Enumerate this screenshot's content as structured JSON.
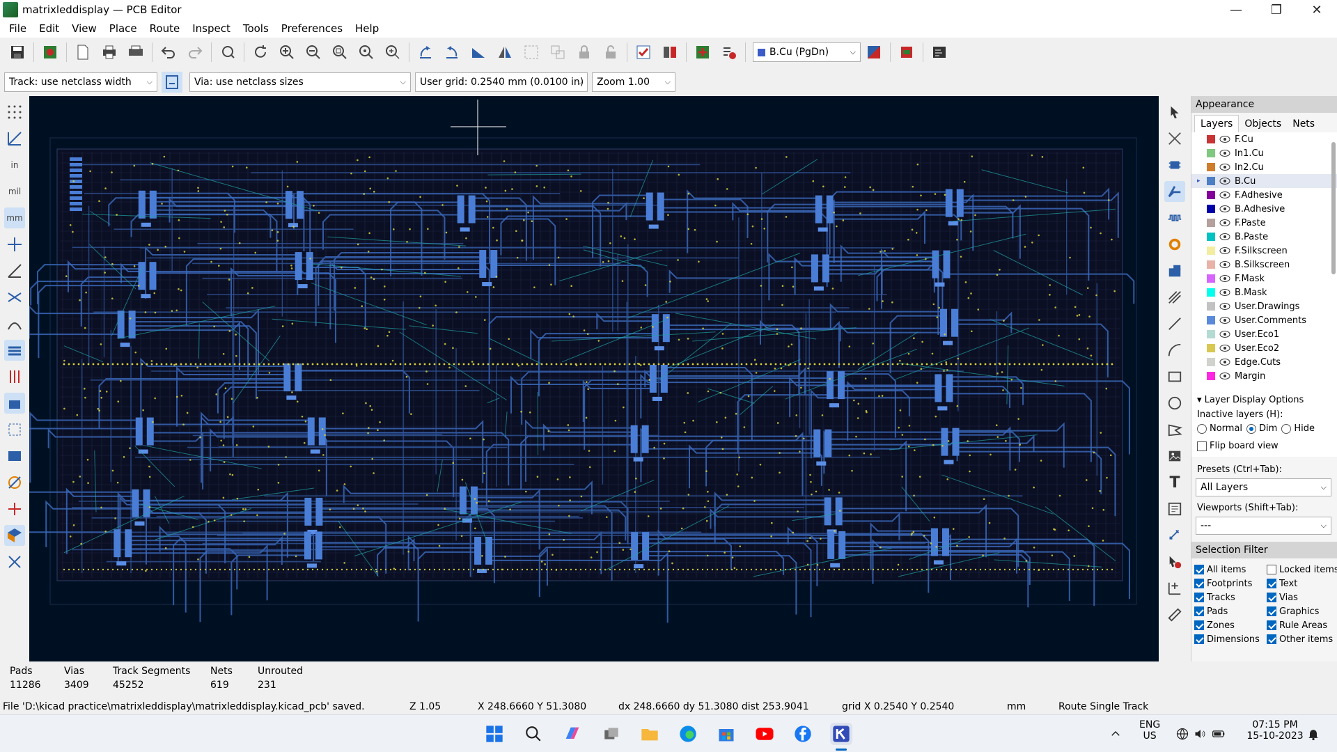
{
  "window": {
    "title": "matrixleddisplay — PCB Editor",
    "controls": [
      "—",
      "❐",
      "✕"
    ]
  },
  "menu": [
    "File",
    "Edit",
    "View",
    "Place",
    "Route",
    "Inspect",
    "Tools",
    "Preferences",
    "Help"
  ],
  "toolbar": {
    "layer_selector": "B.Cu (PgDn)",
    "track_width": "Track: use netclass width",
    "via_size": "Via: use netclass sizes",
    "grid": "User grid: 0.2540 mm (0.0100 in)",
    "zoom": "Zoom 1.00"
  },
  "appearance": {
    "title": "Appearance",
    "tabs": [
      "Layers",
      "Objects",
      "Nets"
    ],
    "layers": [
      {
        "name": "F.Cu",
        "color": "#c83434"
      },
      {
        "name": "In1.Cu",
        "color": "#7fc87f"
      },
      {
        "name": "In2.Cu",
        "color": "#ce7d2c"
      },
      {
        "name": "B.Cu",
        "color": "#4d7fc4"
      },
      {
        "name": "F.Adhesive",
        "color": "#84009b"
      },
      {
        "name": "B.Adhesive",
        "color": "#0000a8"
      },
      {
        "name": "F.Paste",
        "color": "#b4a09c"
      },
      {
        "name": "B.Paste",
        "color": "#00c2c2"
      },
      {
        "name": "F.Silkscreen",
        "color": "#f2eda1"
      },
      {
        "name": "B.Silkscreen",
        "color": "#e8b2a7"
      },
      {
        "name": "F.Mask",
        "color": "#d864ff"
      },
      {
        "name": "B.Mask",
        "color": "#02ffee"
      },
      {
        "name": "User.Drawings",
        "color": "#c2c2c2"
      },
      {
        "name": "User.Comments",
        "color": "#5989db"
      },
      {
        "name": "User.Eco1",
        "color": "#b4dbd2"
      },
      {
        "name": "User.Eco2",
        "color": "#d8c852"
      },
      {
        "name": "Edge.Cuts",
        "color": "#d0d2cd"
      },
      {
        "name": "Margin",
        "color": "#ff26e2"
      }
    ],
    "current_layer": "B.Cu",
    "layer_display_options": "Layer Display Options",
    "inactive_layers_label": "Inactive layers (H):",
    "inactive_options": [
      "Normal",
      "Dim",
      "Hide"
    ],
    "inactive_selected": "Dim",
    "flip_board": "Flip board view",
    "presets_label": "Presets (Ctrl+Tab):",
    "presets_value": "All Layers",
    "viewports_label": "Viewports (Shift+Tab):",
    "viewports_value": "---"
  },
  "selection_filter": {
    "title": "Selection Filter",
    "items": [
      {
        "label": "All items",
        "checked": true
      },
      {
        "label": "Locked items",
        "checked": false
      },
      {
        "label": "Footprints",
        "checked": true
      },
      {
        "label": "Text",
        "checked": true
      },
      {
        "label": "Tracks",
        "checked": true
      },
      {
        "label": "Vias",
        "checked": true
      },
      {
        "label": "Pads",
        "checked": true
      },
      {
        "label": "Graphics",
        "checked": true
      },
      {
        "label": "Zones",
        "checked": true
      },
      {
        "label": "Rule Areas",
        "checked": true
      },
      {
        "label": "Dimensions",
        "checked": true
      },
      {
        "label": "Other items",
        "checked": true
      }
    ]
  },
  "stats": [
    {
      "label": "Pads",
      "value": "11286"
    },
    {
      "label": "Vias",
      "value": "3409"
    },
    {
      "label": "Track Segments",
      "value": "45252"
    },
    {
      "label": "Nets",
      "value": "619"
    },
    {
      "label": "Unrouted",
      "value": "231"
    }
  ],
  "status": {
    "message": "File 'D:\\kicad practice\\matrixleddisplay\\matrixleddisplay.kicad_pcb' saved.",
    "zoom": "Z 1.05",
    "position": "X 248.6660  Y 51.3080",
    "delta": "dx 248.6660  dy 51.3080  dist 253.9041",
    "grid": "grid X 0.2540  Y 0.2540",
    "units": "mm",
    "mode": "Route Single Track"
  },
  "taskbar": {
    "lang": "ENG",
    "region": "US",
    "time": "07:15 PM",
    "date": "15-10-2023"
  }
}
